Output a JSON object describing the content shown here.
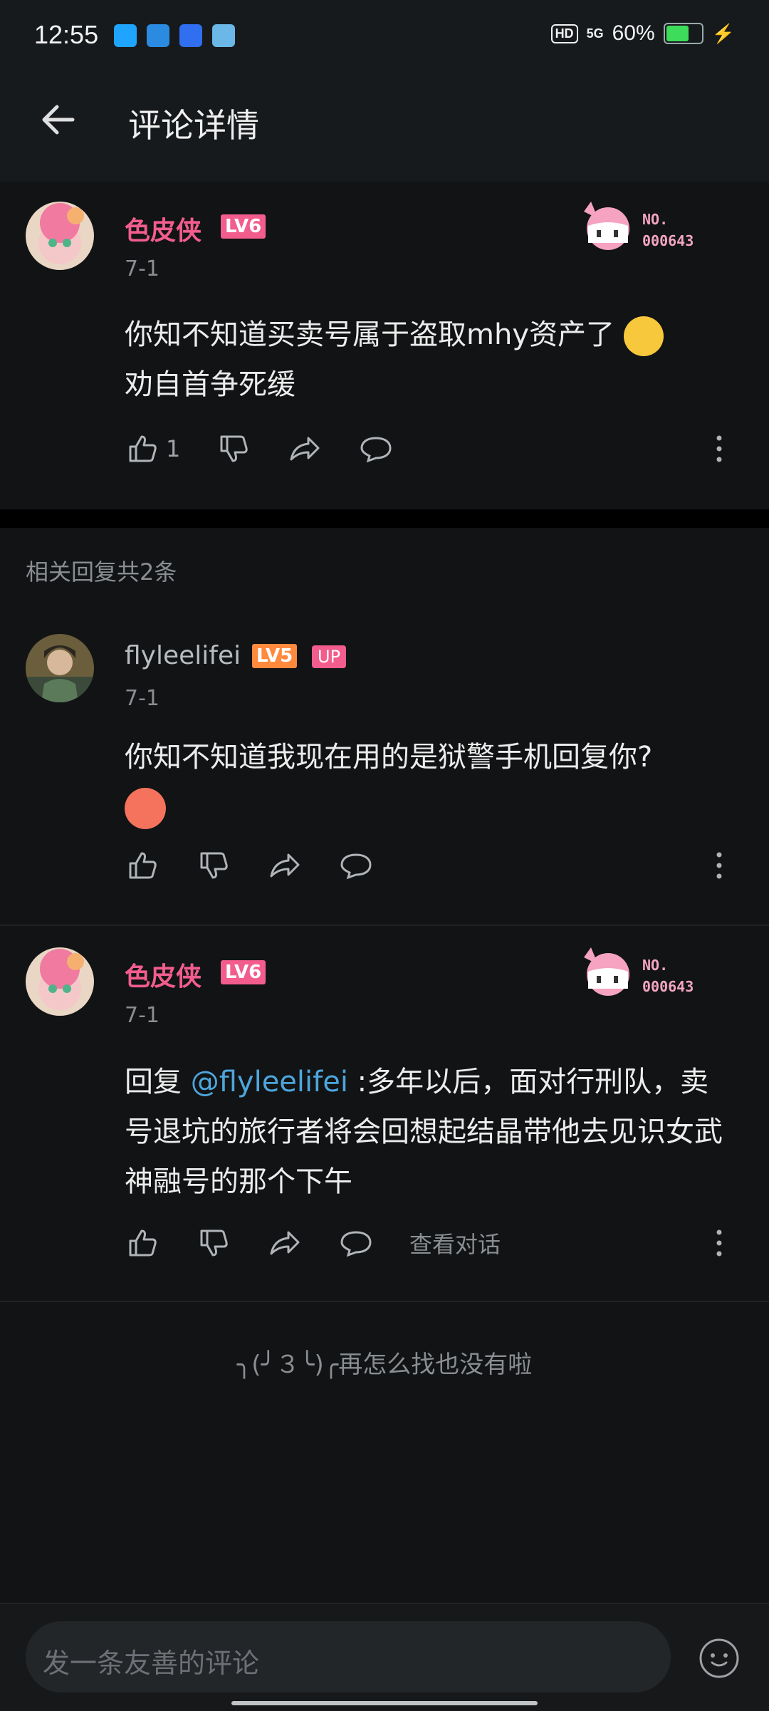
{
  "status": {
    "time": "12:55",
    "battery_text": "60%",
    "hd": "HD",
    "network": "5G"
  },
  "header": {
    "title": "评论详情"
  },
  "main_comment": {
    "username": "色皮侠",
    "level": "LV6",
    "date": "7-1",
    "badge_no": "NO.",
    "badge_num": "000643",
    "text_line1": "你知不知道买卖号属于盗取mhy资产了",
    "text_line2": "劝自首争死缓",
    "likes": "1"
  },
  "related": {
    "label": "相关回复共2条"
  },
  "reply1": {
    "username": "flyleelifei",
    "level": "LV5",
    "up_tag": "UP",
    "date": "7-1",
    "text": "你知不知道我现在用的是狱警手机回复你?"
  },
  "reply2": {
    "username": "色皮侠",
    "level": "LV6",
    "date": "7-1",
    "badge_no": "NO.",
    "badge_num": "000643",
    "reply_prefix": "回复 ",
    "mention": "@flyleelifei",
    "text": " :多年以后，面对行刑队，卖号退坑的旅行者将会回想起结晶带他去见识女武神融号的那个下午",
    "view_conversation": "查看对话"
  },
  "end_text": "╮(╯３╰)╭再怎么找也没有啦",
  "input": {
    "placeholder": "发一条友善的评论"
  }
}
